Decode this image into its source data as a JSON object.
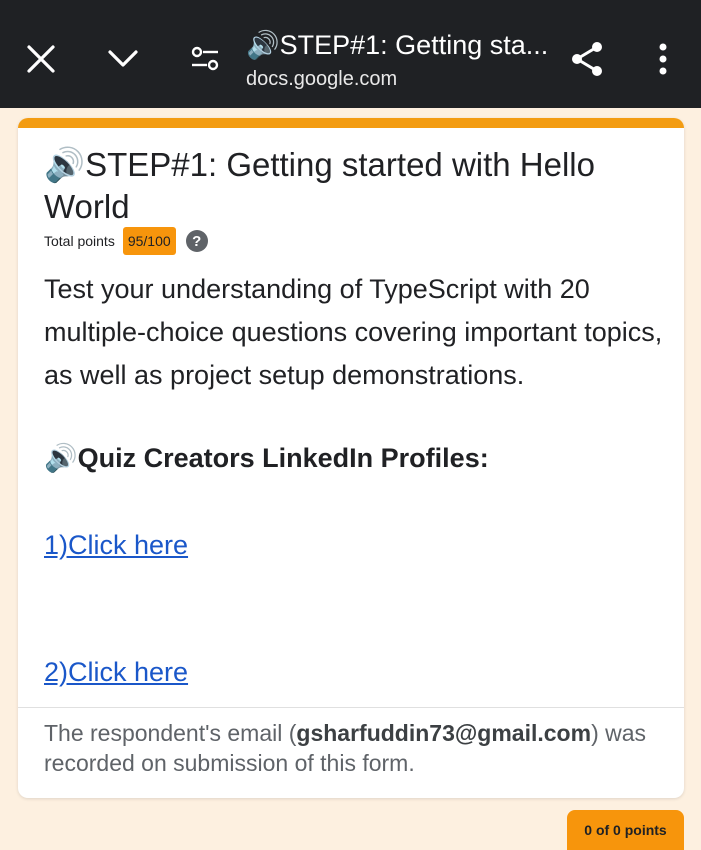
{
  "browser": {
    "title": "🔊STEP#1: Getting sta...",
    "url": "docs.google.com",
    "icons": {
      "close": "close-icon",
      "collapse": "chevron-down-icon",
      "customize": "tune-icon",
      "share": "share-icon",
      "more": "more-vert-icon"
    }
  },
  "form": {
    "title": "🔊STEP#1: Getting started with Hello World",
    "points_label": "Total points",
    "points_value": "95/100",
    "help_glyph": "?",
    "description": "Test your understanding of TypeScript with 20 multiple-choice questions covering important topics, as well as project setup demonstrations.",
    "creators_heading": "🔊Quiz Creators LinkedIn Profiles:",
    "links": [
      {
        "label": "1)Click here"
      },
      {
        "label": "2)Click here"
      }
    ],
    "email_note_prefix": "The respondent's email (",
    "email": "gsharfuddin73@gmail.com",
    "email_note_suffix": ") was recorded on submission of this form."
  },
  "bottom_badge": {
    "label": "0 of 0 points"
  },
  "colors": {
    "accent": "#f39c12",
    "badge": "#f7950c",
    "link": "#1a57c9",
    "topbar": "#1f2124",
    "page_bg": "#fdf0e0"
  }
}
